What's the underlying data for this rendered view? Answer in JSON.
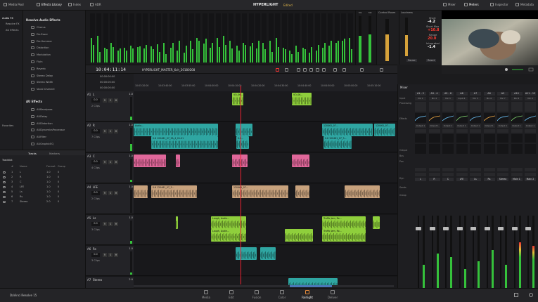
{
  "topbar": {
    "media_pool": "Media Pool",
    "effects_library": "Effects Library",
    "index": "Index",
    "adr": "ADR",
    "project_title": "HYPERLIGHT",
    "project_status": "Edited",
    "mixer": "Mixer",
    "meters": "Meters",
    "inspector": "Inspector",
    "metadata": "Metadata"
  },
  "fx_tree": {
    "items": [
      "Audio FX",
      "Resolve FX",
      "AU Effects",
      "Favorites"
    ]
  },
  "fx_list": {
    "resolve_head": "Resolve Audio Effects",
    "resolve_items": [
      "Chorus",
      "De-Esser",
      "De-Hummer",
      "Distortion",
      "Modulation",
      "Flyin",
      "Reverb",
      "Stereo Delay",
      "Stereo Width",
      "Vocal Channel"
    ],
    "au_head": "AU Effects",
    "au_items": [
      "AUBandpass",
      "AUDelay",
      "AUDistortion",
      "AUDynamicsProcessor",
      "AUFilter",
      "AUGraphicEQ"
    ]
  },
  "tabs": {
    "tracks": "Tracks",
    "markers": "Markers"
  },
  "tracklist": {
    "title": "Tracklist",
    "headers": [
      "#",
      "Name",
      "Format",
      "Group"
    ],
    "rows": [
      {
        "num": "1",
        "name": "L",
        "format": "1.0",
        "group": "0"
      },
      {
        "num": "2",
        "name": "R",
        "format": "1.0",
        "group": "0"
      },
      {
        "num": "3",
        "name": "C",
        "format": "1.0",
        "group": "0"
      },
      {
        "num": "4",
        "name": "LFE",
        "format": "1.0",
        "group": "0"
      },
      {
        "num": "5",
        "name": "Ls",
        "format": "1.0",
        "group": "0"
      },
      {
        "num": "6",
        "name": "Rs",
        "format": "1.0",
        "group": "0"
      },
      {
        "num": "7",
        "name": "Stereo",
        "format": "2.0",
        "group": "0"
      }
    ]
  },
  "meters": {
    "labels": [
      "A1",
      "A2",
      "A3",
      "A4",
      "A5",
      "A6",
      "A7"
    ],
    "master_labels": [
      "M1",
      "M2"
    ],
    "control_room_title": "Control Room",
    "loudness_title": "Loudness",
    "loudness": {
      "short_label": "Short",
      "short_value": "-4.2",
      "short_max_label": "Short Max",
      "short_max_value": "+10.8",
      "range_label": "Range",
      "range_value": "20.0",
      "integrated_label": "Integrated",
      "integrated_value": "-1.4",
      "pause": "Pause",
      "reset": "Reset"
    }
  },
  "timeline": {
    "timecode": "10:04:11:14",
    "name": "HYPERLIGHT_MASTER_6ch_20180208",
    "tc_rows": [
      "00:00:00:00",
      "00:00:00:00",
      "00:00:00:00"
    ],
    "ruler": [
      "10:03:20:00",
      "10:03:40:00",
      "10:03:55:00",
      "10:04:00:00",
      "10:04:10:00",
      "10:04:20:00",
      "10:04:30:00",
      "10:04:40:00",
      "10:04:50:00",
      "10:05:00:00",
      "10:05:10:00"
    ]
  },
  "tracks": [
    {
      "id": "A1",
      "name": "L",
      "vol": "0.0",
      "clips": "2 Clips",
      "level": "1.0",
      "meter": 0.15,
      "clips_list": [
        {
          "label": "VO_06..."
        },
        {
          "label": "VO_06..."
        }
      ]
    },
    {
      "id": "A2",
      "name": "R",
      "vol": "0.0",
      "clips": "7 Clips",
      "level": "1.0",
      "meter": 0.3,
      "clips_list": [
        {
          "label": "Audio..."
        },
        {
          "label": "0.6 120461_07_3A_4_01-01"
        },
        {
          "label": "0.6 120461_07_3..."
        },
        {
          "label": "0.6 120461_07..."
        },
        {
          "label": "0.6..."
        },
        {
          "label": "120461_07..."
        },
        {
          "label": "120461_07..."
        }
      ]
    },
    {
      "id": "A3",
      "name": "C",
      "vol": "0.0",
      "clips": "4 Clips",
      "level": "1.0",
      "meter": 0.1,
      "clips_list": []
    },
    {
      "id": "A4",
      "name": "LFE",
      "vol": "0.0",
      "clips": "2 Clips",
      "level": "1.0",
      "meter": 0.0,
      "clips_list": [
        {
          "label": "0.6 120461_07_3..."
        },
        {
          "label": "120461_07..."
        }
      ]
    },
    {
      "id": "A5",
      "name": "Ls",
      "vol": "0.0",
      "clips": "3 Clips",
      "level": "1.0",
      "meter": 0.12,
      "clips_list": [
        {
          "label": "Laugh, Audie..."
        },
        {
          "label": "Laugh, Audie..."
        },
        {
          "label": "Traffic Jam, Ro..."
        },
        {
          "label": "Traffic Jam, Ro..."
        }
      ]
    },
    {
      "id": "A6",
      "name": "Rs",
      "vol": "0.0",
      "clips": "3 Clips",
      "level": "1.0",
      "meter": 0.1,
      "clips_list": []
    },
    {
      "id": "A7",
      "name": "Stereo",
      "vol": "0.0",
      "clips": "",
      "level": "2.0",
      "meter": 0.0,
      "clips_list": []
    }
  ],
  "mixer": {
    "title": "Mixer",
    "row_labels": [
      "Input",
      "Processing",
      "Effects",
      "Output",
      "Bus",
      "Pan",
      "Dyn",
      "Sends",
      "Group"
    ],
    "channels": [
      {
        "head": "A1 - 2",
        "input": "Mic 1",
        "out": "Output 1",
        "name": "L"
      },
      {
        "head": "A3 - 4",
        "input": "Mic 2",
        "out": "Output 1",
        "name": "R"
      },
      {
        "head": "A5 - 6",
        "input": "Mic 3",
        "out": "Output 1",
        "name": "C"
      },
      {
        "head": "A6",
        "input": "Input 4",
        "out": "Output 1",
        "name": "LFE"
      },
      {
        "head": "A7",
        "input": "Mic 5",
        "out": "Output 1",
        "name": "Ls"
      },
      {
        "head": "A8",
        "input": "Mic 6",
        "out": "Output 1",
        "name": "Rs"
      },
      {
        "head": "A9",
        "input": "Mic 7",
        "out": "Output 1",
        "name": "Stereo"
      },
      {
        "head": "A10",
        "input": "Mic 8",
        "out": "Output 1",
        "name": "Main 1"
      },
      {
        "head": "A11 - 12",
        "input": "Mic 9",
        "out": "Output 1",
        "name": "Main 2"
      }
    ],
    "fader_levels": [
      0.35,
      0.5,
      0.45,
      0.3,
      0.4,
      0.55,
      0.35,
      0.65,
      0.6
    ]
  },
  "pages": [
    "Media",
    "Edit",
    "Fusion",
    "Color",
    "Fairlight",
    "Deliver"
  ],
  "active_page": "Fairlight",
  "brand": "DaVinci Resolve 15",
  "colors": {
    "accent": "#e48a3a",
    "meter_green": "#35c23b",
    "clip_green": "#7fbf3a",
    "clip_teal": "#2fa6a2",
    "clip_pink": "#e0679a",
    "clip_tan": "#c8a27d",
    "clip_lime": "#8fcf3c"
  }
}
